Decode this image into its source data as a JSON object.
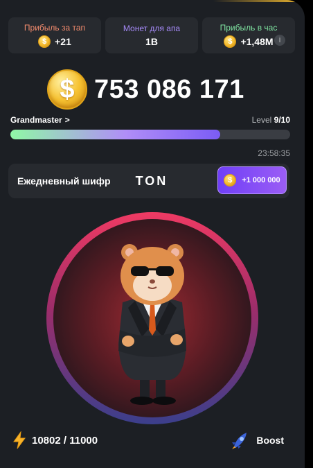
{
  "stats": [
    {
      "label": "Прибыль за тап",
      "value": "+21",
      "label_color": "#f28b6d",
      "has_coin": true
    },
    {
      "label": "Монет для апа",
      "value": "1B",
      "label_color": "#a78bfa",
      "has_coin": false
    },
    {
      "label": "Прибыль в час",
      "value": "+1,48M",
      "label_color": "#7fe3a1",
      "has_coin": true
    }
  ],
  "info_icon": "i",
  "balance": {
    "value": "753 086 171",
    "coin_symbol": "$"
  },
  "level": {
    "rank": "Grandmaster",
    "rank_chevron": ">",
    "prefix": "Level",
    "value": "9/10",
    "progress_percent": 75
  },
  "timer": "23:58:35",
  "cipher": {
    "label": "Ежедневный шифр",
    "word": "TON",
    "reward": "+1 000 000"
  },
  "energy": {
    "value": "10802 / 11000"
  },
  "boost": {
    "label": "Boost"
  },
  "colors": {
    "background": "#1c1f24",
    "card": "#272a2f",
    "accent": "#f3ba2f",
    "purple": "#7b5cf5"
  }
}
